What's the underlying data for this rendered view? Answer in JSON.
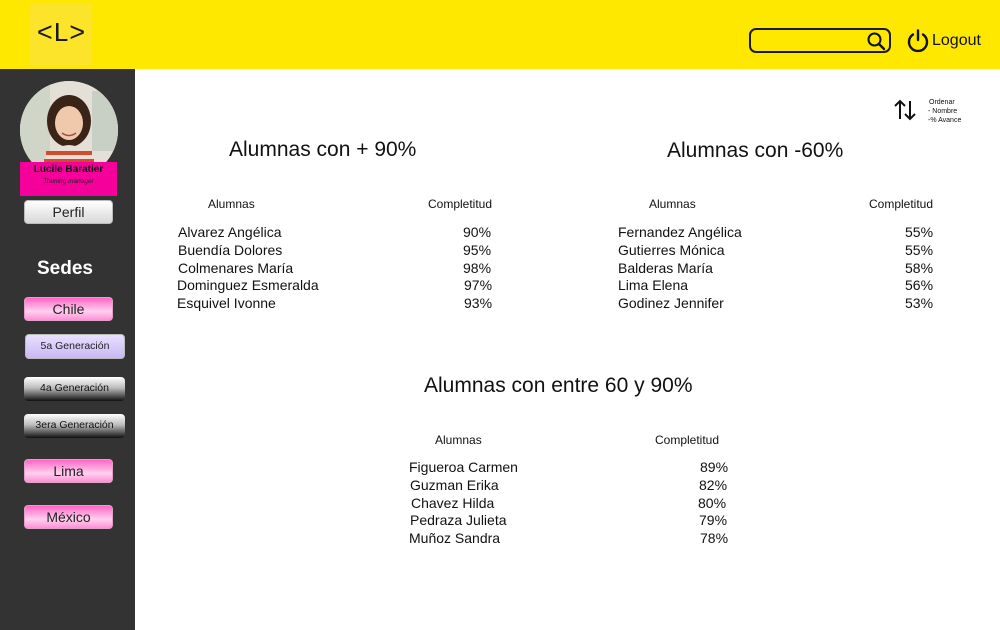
{
  "header": {
    "logo_text": "<L>",
    "search": {
      "placeholder": "",
      "value": ""
    },
    "logout_label": "Logout"
  },
  "sidebar": {
    "user": {
      "name": "Lucile Baratier",
      "role": "Training manager"
    },
    "perfil_label": "Perfil",
    "sedes_title": "Sedes",
    "items": [
      {
        "label": "Chile"
      },
      {
        "label": "5a Generación"
      },
      {
        "label": "4a Generación"
      },
      {
        "label": "3era Generación"
      },
      {
        "label": "Lima"
      },
      {
        "label": "México"
      }
    ]
  },
  "sort": {
    "title": "Ordenar",
    "options": [
      "- Nombre",
      "-% Avance"
    ]
  },
  "sections": [
    {
      "title": "Alumnas con + 90%",
      "col_name": "Alumnas",
      "col_value": "Completitud",
      "rows": [
        {
          "name": "Alvarez Angélica",
          "value": "90%"
        },
        {
          "name": "Buendía Dolores",
          "value": "95%"
        },
        {
          "name": "Colmenares María",
          "value": "98%"
        },
        {
          "name": "Dominguez Esmeralda",
          "value": "97%"
        },
        {
          "name": "Esquivel Ivonne",
          "value": "93%"
        }
      ]
    },
    {
      "title": "Alumnas con -60%",
      "col_name": "Alumnas",
      "col_value": "Completitud",
      "rows": [
        {
          "name": "Fernandez Angélica",
          "value": "55%"
        },
        {
          "name": "Gutierres Mónica",
          "value": "55%"
        },
        {
          "name": "Balderas María",
          "value": "58%"
        },
        {
          "name": "Lima Elena",
          "value": "56%"
        },
        {
          "name": "Godinez Jennifer",
          "value": "53%"
        }
      ]
    },
    {
      "title": "Alumnas con entre 60 y 90%",
      "col_name": "Alumnas",
      "col_value": "Completitud",
      "rows": [
        {
          "name": "Figueroa Carmen",
          "value": "89%"
        },
        {
          "name": "Guzman Erika",
          "value": "82%"
        },
        {
          "name": "Chavez Hilda",
          "value": "80%"
        },
        {
          "name": "Pedraza Julieta",
          "value": "79%"
        },
        {
          "name": "Muñoz Sandra",
          "value": "78%"
        }
      ]
    }
  ],
  "colors": {
    "header_bg": "#ffe800",
    "sidebar_bg": "#333333",
    "accent_pink": "#f5009b"
  }
}
